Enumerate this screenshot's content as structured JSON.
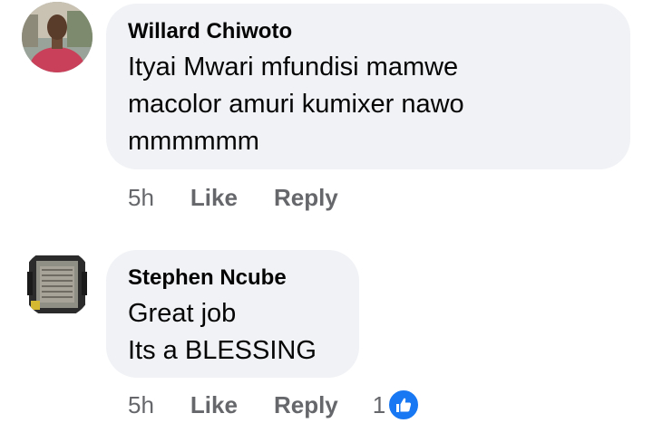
{
  "comments": [
    {
      "author": "Willard Chiwoto",
      "lines": [
        "Ityai Mwari mfundisi mamwe",
        "macolor amuri kumixer nawo",
        "mmmmmm"
      ],
      "time": "5h",
      "like_label": "Like",
      "reply_label": "Reply"
    },
    {
      "author": "Stephen Ncube",
      "lines": [
        "Great job",
        "Its a BLESSING"
      ],
      "time": "5h",
      "like_label": "Like",
      "reply_label": "Reply",
      "reaction_count": "1",
      "reaction_icon": "thumbs-up-icon"
    }
  ],
  "colors": {
    "bubble": "#f0f2f5",
    "meta": "#65676b",
    "like_blue": "#1877f2"
  }
}
